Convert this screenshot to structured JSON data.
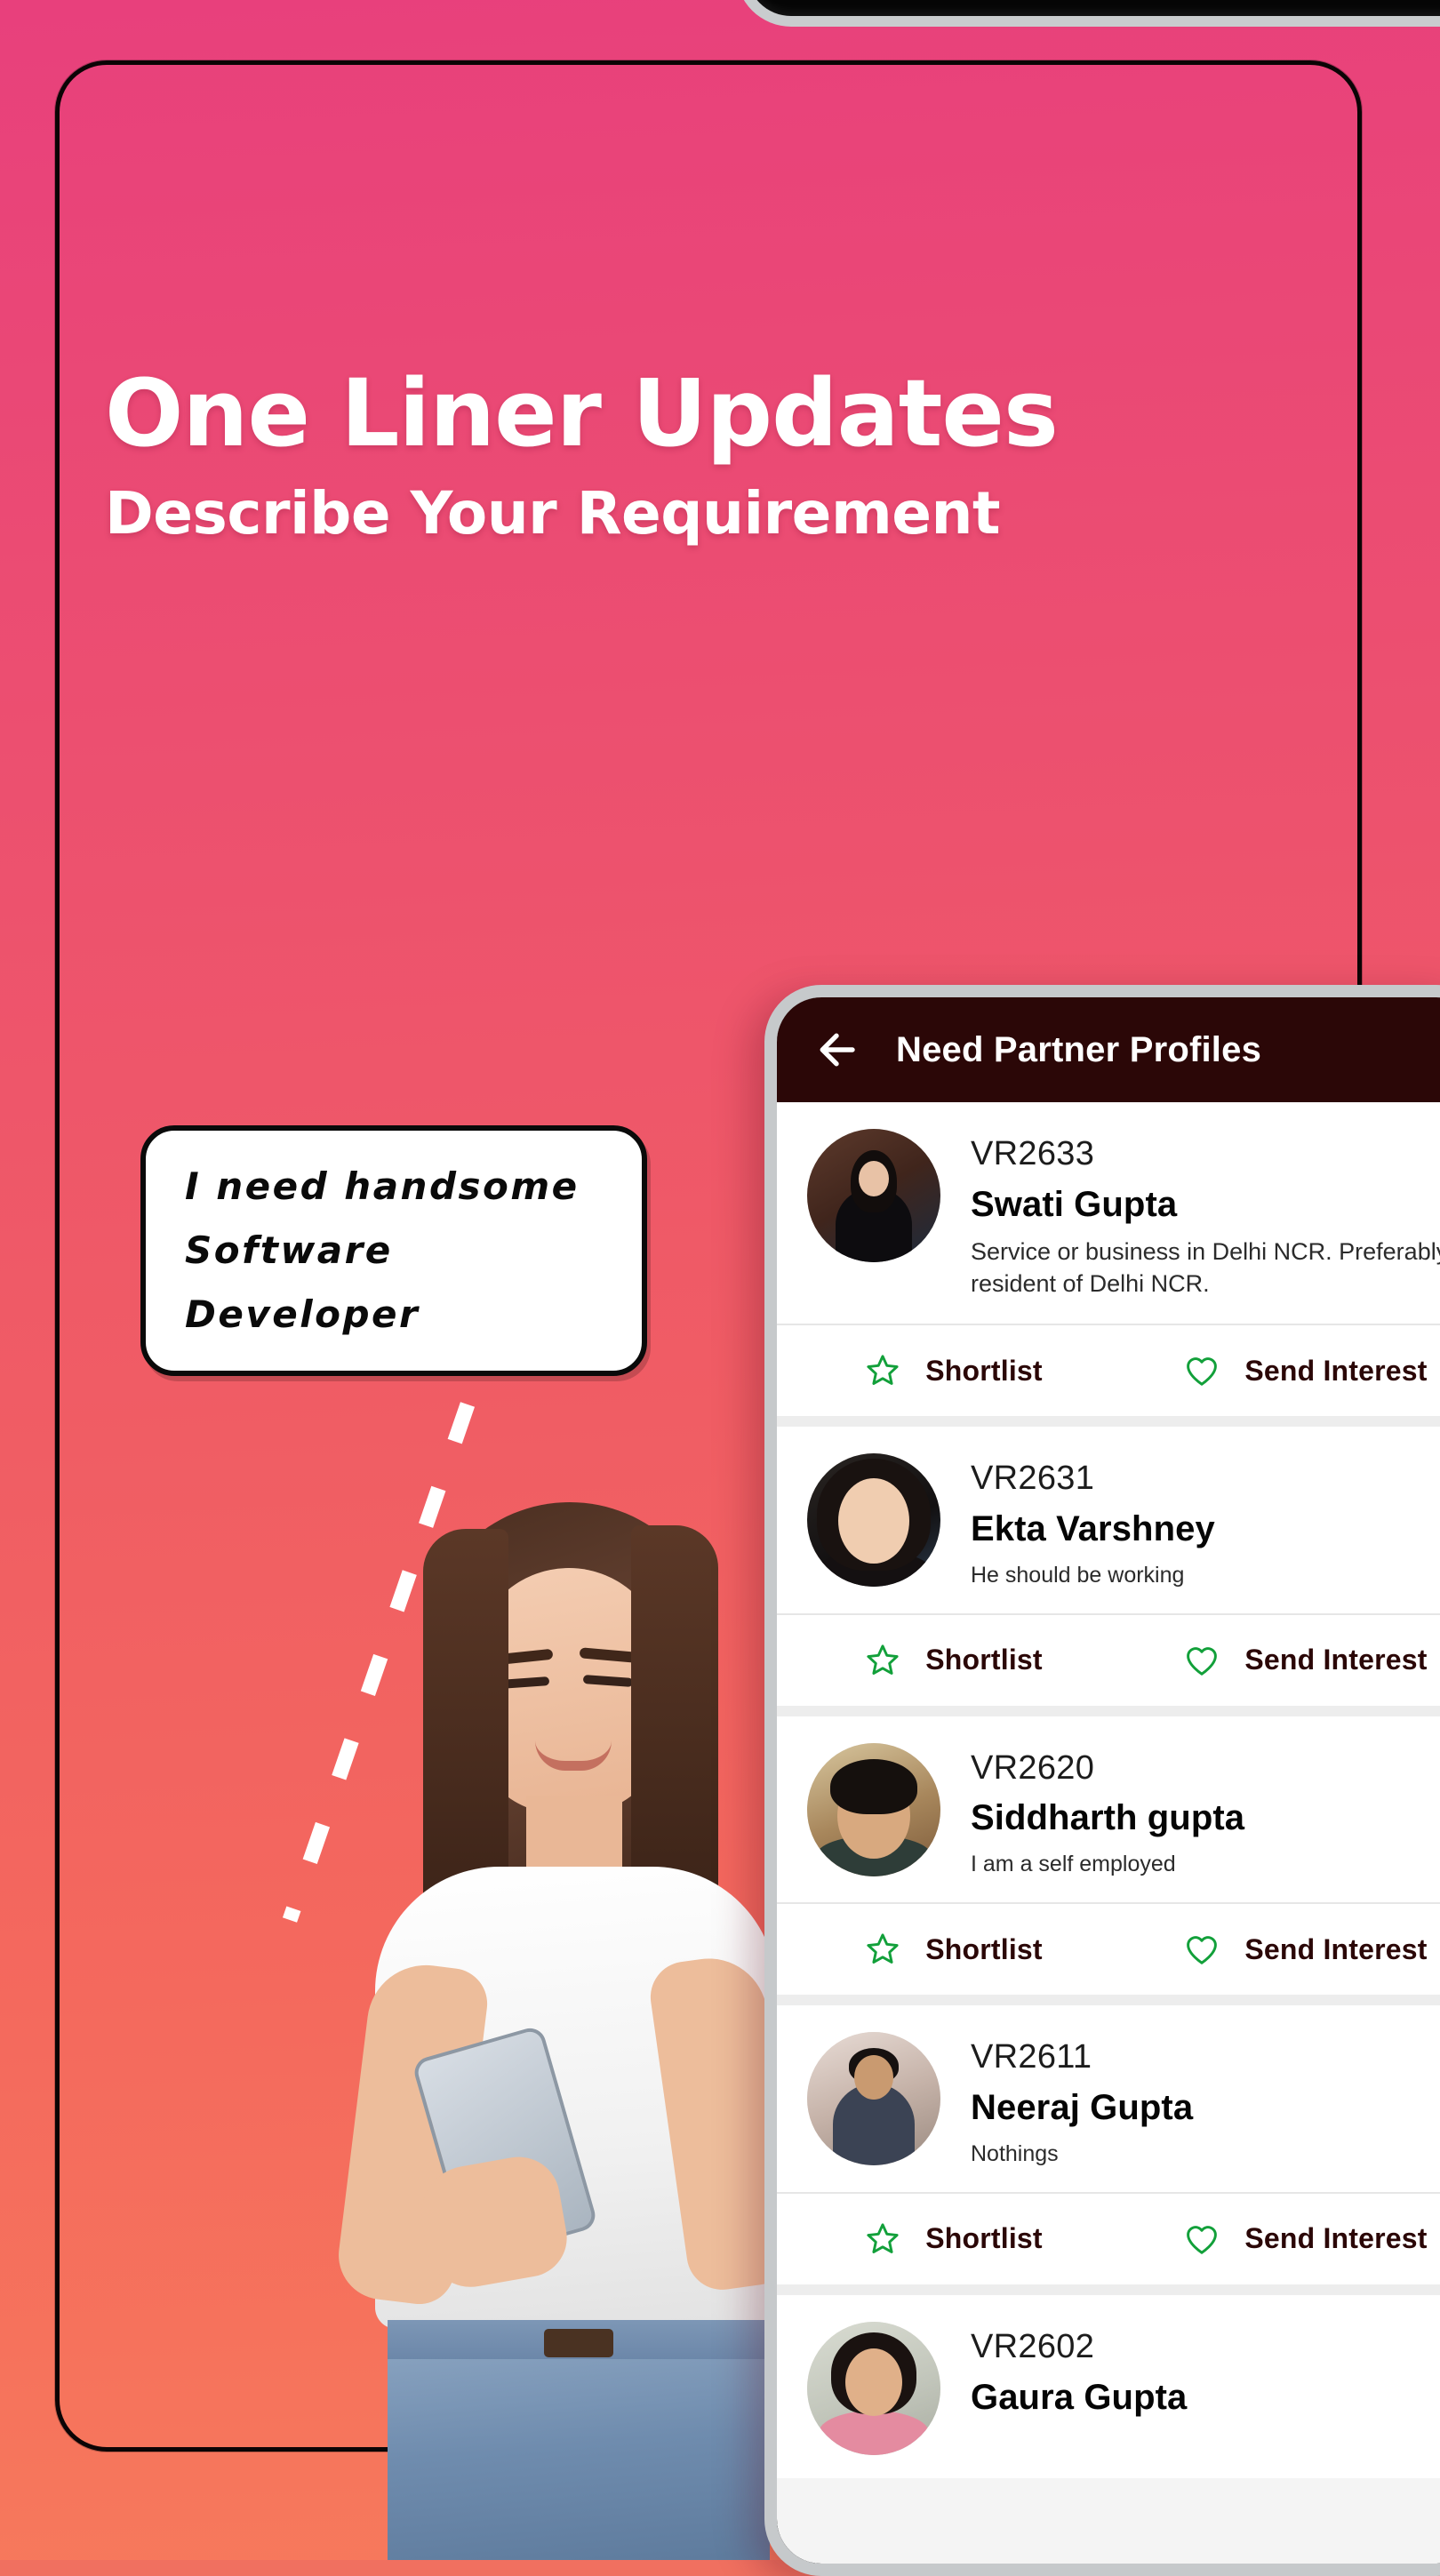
{
  "promo": {
    "headline_line1": "One Liner Updates",
    "headline_line2": "Describe Your Requirement",
    "speech_bubble_line1": "I need handsome",
    "speech_bubble_line2": "Software Developer",
    "gradient_start": "#e8407c",
    "gradient_end": "#f77a5c"
  },
  "app": {
    "header": {
      "back_icon": "back-arrow-icon",
      "title": "Need Partner Profiles",
      "bar_color": "#2b0707",
      "title_color": "#ffffff"
    },
    "actions": {
      "shortlist_label": "Shortlist",
      "shortlist_icon": "star-outline-icon",
      "send_interest_label": "Send Interest",
      "send_interest_icon": "heart-outline-icon",
      "icon_color": "#12a03a",
      "label_color": "#2b0707"
    },
    "profiles": [
      {
        "id": "VR2633",
        "name": "Swati Gupta",
        "description": "Service or business in Delhi NCR.  Preferably resident of Delhi NCR."
      },
      {
        "id": "VR2631",
        "name": "Ekta Varshney",
        "description": "He should be working"
      },
      {
        "id": "VR2620",
        "name": "Siddharth gupta",
        "description": "I am a self employed"
      },
      {
        "id": "VR2611",
        "name": "Neeraj Gupta",
        "description": "Nothings"
      },
      {
        "id": "VR2602",
        "name": "Gaura Gupta",
        "description": ""
      }
    ]
  }
}
